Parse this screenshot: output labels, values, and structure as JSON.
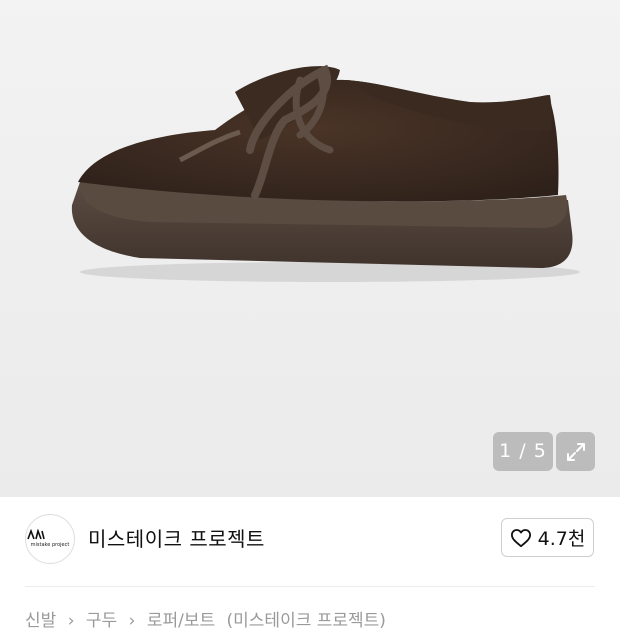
{
  "gallery": {
    "image_alt": "brown suede lace-up shoe",
    "counter": "1 / 5",
    "expand_icon": "expand-arrows-icon"
  },
  "brand": {
    "name": "미스테이크 프로젝트",
    "logo_text": "mistake project",
    "like_icon": "heart-outline-icon",
    "like_count": "4.7천"
  },
  "breadcrumb": {
    "items": [
      "신발",
      "구두",
      "로퍼/보트",
      "(미스테이크 프로젝트)"
    ]
  },
  "colors": {
    "gallery_bg": "#eeeeee",
    "text_primary": "#111111",
    "text_secondary": "#9a9a9a"
  }
}
